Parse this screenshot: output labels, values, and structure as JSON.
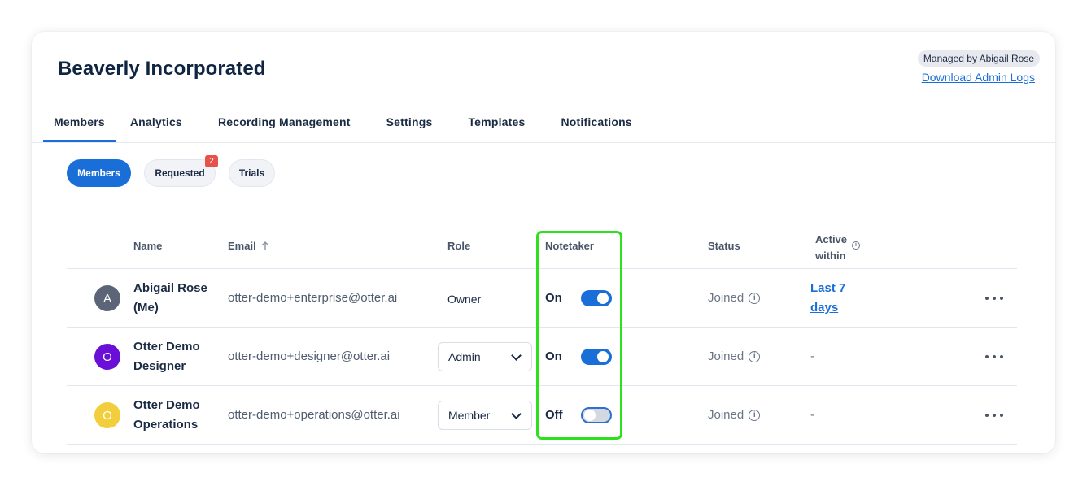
{
  "header": {
    "org_name": "Beaverly Incorporated",
    "managed_by": "Managed by Abigail Rose",
    "download_logs": "Download Admin Logs"
  },
  "tabs": [
    {
      "label": "Members",
      "active": true
    },
    {
      "label": "Analytics"
    },
    {
      "label": "Recording Management"
    },
    {
      "label": "Settings"
    },
    {
      "label": "Templates"
    },
    {
      "label": "Notifications"
    }
  ],
  "filters": {
    "members": "Members",
    "requested": "Requested",
    "requested_count": "2",
    "trials": "Trials"
  },
  "table": {
    "headers": {
      "name": "Name",
      "email": "Email",
      "role": "Role",
      "notetaker": "Notetaker",
      "status": "Status",
      "active_within_1": "Active",
      "active_within_2": "within"
    },
    "rows": [
      {
        "initial": "A",
        "avatar_color": "#5b6577",
        "name": "Abigail Rose (Me)",
        "email": "otter-demo+enterprise@otter.ai",
        "role": "Owner",
        "notetaker": "On",
        "status": "Joined",
        "active_within": "Last 7 days"
      },
      {
        "initial": "O",
        "avatar_color": "#6a0fd6",
        "name": "Otter Demo Designer",
        "email": "otter-demo+designer@otter.ai",
        "role": "Admin",
        "notetaker": "On",
        "status": "Joined",
        "active_within": "-"
      },
      {
        "initial": "O",
        "avatar_color": "#f2ce3c",
        "name": "Otter Demo Operations",
        "email": "otter-demo+operations@otter.ai",
        "role": "Member",
        "notetaker": "Off",
        "status": "Joined",
        "active_within": "-"
      }
    ]
  },
  "colors": {
    "accent": "#1a6ed8",
    "highlight": "#2fe01e",
    "badge": "#e5534b"
  }
}
